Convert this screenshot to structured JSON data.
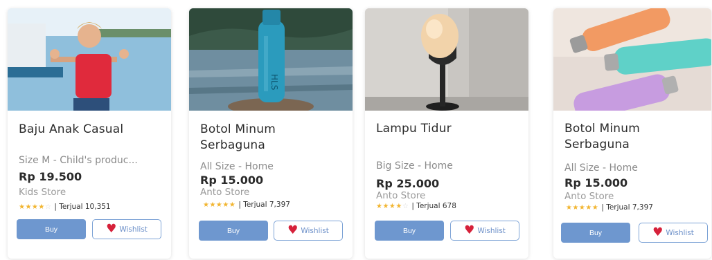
{
  "products": [
    {
      "title": "Baju Anak Casual",
      "variant": "Size M - Child's produc...",
      "price": "Rp 19.500",
      "store": "Kids Store",
      "stars": "★★★★",
      "stars_empty": "☆",
      "sold": "| Terjual 10,351",
      "buy_label": "Buy",
      "wishlist_label": "Wishlist"
    },
    {
      "title": "Botol Minum Serbaguna",
      "variant": "All Size - Home",
      "price": "Rp 15.000",
      "store": "Anto Store",
      "stars": "★★★★★",
      "stars_empty": "",
      "sold": "| Terjual 7,397",
      "buy_label": "Buy",
      "wishlist_label": "Wishlist"
    },
    {
      "title": "Lampu Tidur",
      "variant": "Big Size - Home",
      "price": "Rp 25.000",
      "store": "Anto Store",
      "stars": "★★★★",
      "stars_empty": "☆",
      "sold": "| Terjual 678",
      "buy_label": "Buy",
      "wishlist_label": "Wishlist"
    },
    {
      "title": "Botol Minum Serbaguna",
      "variant": "All Size - Home",
      "price": "Rp 15.000",
      "store": "Anto Store",
      "stars": "★★★★★",
      "stars_empty": "",
      "sold": "| Terjual 7,397",
      "buy_label": "Buy",
      "wishlist_label": "Wishlist"
    }
  ],
  "colors": {
    "buy_button": "#6e97cf",
    "wishlist_border": "#7da3d6",
    "heart": "#d6213a",
    "star": "#f2b530"
  }
}
